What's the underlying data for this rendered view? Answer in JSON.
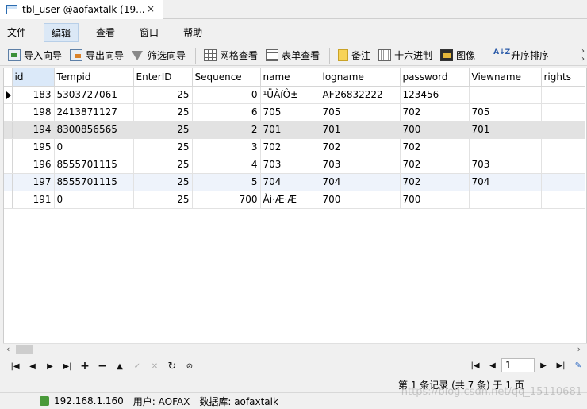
{
  "tab": {
    "title": "tbl_user @aofaxtalk (19...",
    "close": "×"
  },
  "menu": [
    "文件",
    "编辑",
    "查看",
    "窗口",
    "帮助"
  ],
  "toolbar": {
    "import": "导入向导",
    "export": "导出向导",
    "filter": "筛选向导",
    "grid_view": "网格查看",
    "form_view": "表单查看",
    "note": "备注",
    "hex": "十六进制",
    "image": "图像",
    "sort": "升序排序",
    "sort_icon_text": "A↓Z"
  },
  "table": {
    "columns": [
      "id",
      "Tempid",
      "EnterID",
      "Sequence",
      "name",
      "logname",
      "password",
      "Viewname",
      "rights"
    ],
    "rows": [
      [
        "183",
        "5303727061",
        "25",
        "0",
        "¹ÜÀíÔ±",
        "AF26832222",
        "123456",
        "",
        ""
      ],
      [
        "198",
        "2413871127",
        "25",
        "6",
        "705",
        "705",
        "702",
        "705",
        ""
      ],
      [
        "194",
        "8300856565",
        "25",
        "2",
        "701",
        "701",
        "700",
        "701",
        ""
      ],
      [
        "195",
        "0",
        "25",
        "3",
        "702",
        "702",
        "702",
        "",
        ""
      ],
      [
        "196",
        "8555701115",
        "25",
        "4",
        "703",
        "703",
        "702",
        "703",
        ""
      ],
      [
        "197",
        "8555701115",
        "25",
        "5",
        "704",
        "704",
        "702",
        "704",
        ""
      ],
      [
        "191",
        "0",
        "25",
        "700",
        "Àì·Æ·Æ",
        "700",
        "700",
        "",
        ""
      ]
    ]
  },
  "nav": {
    "page": "1"
  },
  "status": {
    "records": "第 1 条记录 (共 7 条) 于 1 页",
    "host": "192.168.1.160",
    "user": "用户: AOFAX",
    "database": "数据库: aofaxtalk"
  },
  "watermark": "https://blog.csdn.net/qq_15110681"
}
